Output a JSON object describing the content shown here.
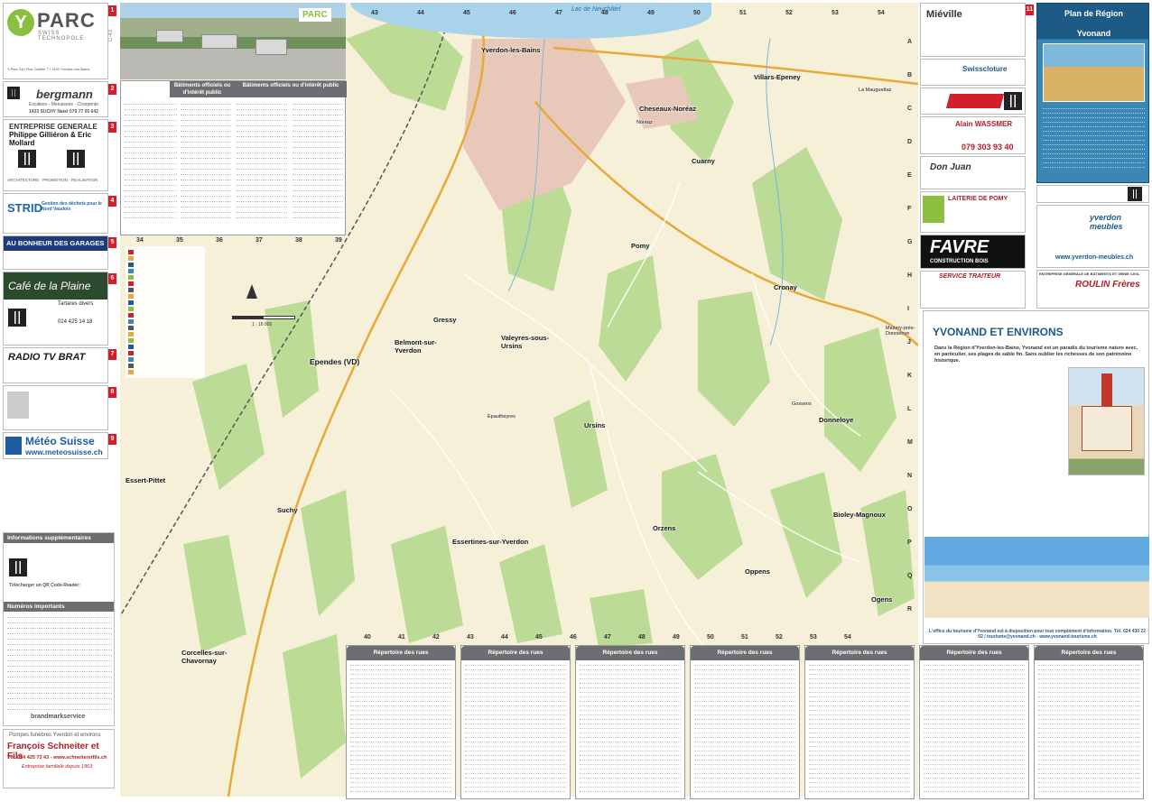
{
  "left": {
    "parc_logo": "Y",
    "parc_name": "PARC",
    "parc_sub": "SWISS TECHNOPOLE",
    "parc_addr": "Y-Parc SA  I  Rue Galilée 7  I  1400 Yverdon-les-Bains",
    "bergmann": "bergmann",
    "bergmann_sub": "Escaliers - Menuiserie - Charpente",
    "bergmann_tel": "1433 SUCHY    Natel 079 77 55 642",
    "entreprise_title": "ENTREPRISE GENERALE",
    "entreprise_names": "Philippe Gilliéron & Eric Mollard",
    "entreprise_foot": "ARCHITECTURE - PROMOTION - REALISATION",
    "strid_name": "STRID",
    "strid_tag": "Gestion des déchets pour le Nord Vaudois",
    "garage_title": "AU BONHEUR DES GARAGES",
    "cafe_title": "Café de la Plaine",
    "cafe_sub": "Tartares divers",
    "cafe_tel": "024 425 14 18",
    "radio_title": "RADIO TV BRAT",
    "meteo_title": "Météo Suisse",
    "meteo_url": "www.meteosuisse.ch",
    "info_head": "Informations supplémentaires",
    "qr_title": "Télécharger un QR Code-Reader:",
    "numeros_head": "Numéros importants",
    "brand": "brandmarkservice",
    "pompes_top": "Pompes funèbres Yverdon et environs",
    "pompes_name": "François Schneiter et Fils",
    "pompes_tel": "Tél. 024 425 73 43 - www.schneiteretfils.ch",
    "pompes_foot": "Entreprise familiale depuis 1963"
  },
  "map": {
    "lake": "Lac de Neuchâtel",
    "inset_logo": "PARC",
    "poi_head_left": "Bâtiments officiels ou d'intérêt public",
    "poi_head_right": "Bâtiments officiels ou d'intérêt public",
    "places": {
      "yverdon": "Yverdon-les-Bains",
      "cheseaux": "Cheseaux-Noréaz",
      "villars": "Villars-Epeney",
      "cuarny": "Cuarny",
      "pomy": "Pomy",
      "cronay": "Cronay",
      "gressy": "Gressy",
      "belmont": "Belmont-sur-Yverdon",
      "ependes": "Ependes (VD)",
      "valeyres": "Valeyres-sous-Ursins",
      "ursins": "Ursins",
      "donneloye": "Donneloye",
      "essert": "Essert-Pittet",
      "suchy": "Suchy",
      "essertines": "Essertines-sur-Yverdon",
      "orzens": "Orzens",
      "bioley": "Bioley-Magnoux",
      "oppens": "Oppens",
      "ogens": "Ogens",
      "corcelles": "Corcelles-sur-Chavornay",
      "gossens": "Gossens",
      "mezery": "Mézery-près-Donneloye",
      "epautheyres": "Epautheyres",
      "noreaz": "Noréaz",
      "lamauguettaz": "La Mauguettaz"
    },
    "top_numbers": [
      "43",
      "44",
      "45",
      "46",
      "47",
      "48",
      "49",
      "50",
      "51",
      "52",
      "53",
      "54"
    ],
    "bottom_numbers": [
      "40",
      "41",
      "42",
      "43",
      "44",
      "45",
      "46",
      "47",
      "48",
      "49",
      "50",
      "51",
      "52",
      "53",
      "54"
    ],
    "left_numbers": [
      "34",
      "35",
      "36",
      "37",
      "38",
      "39"
    ],
    "side_letters": [
      "A",
      "B",
      "C",
      "D",
      "E",
      "F",
      "G",
      "H",
      "I",
      "J",
      "K",
      "L",
      "M",
      "N",
      "O",
      "P",
      "Q",
      "R"
    ],
    "scale_label": "1 : 16 000"
  },
  "index": {
    "header": "Répertoire des rues"
  },
  "right": {
    "mieville": "Miéville",
    "swisscloture": "Swisscloture",
    "wassmer_name": "Alain WASSMER",
    "wassmer_tel": "079 303 93 40",
    "wassmer_sub": "Dépannage  Chauffage, brûleurs sanitaire, solaire",
    "donjuan": "Don Juan",
    "laiterie": "LAITERIE DE POMY",
    "favre": "FAVRE",
    "favre_sub": "CONSTRUCTION BOIS",
    "traiteur": "SERVICE TRAITEUR",
    "yverdon_meubles": "yverdon meubles",
    "yverdon_meubles_url": "www.yverdon-meubles.ch",
    "roulin": "ROULIN Frères",
    "roulin_head": "ENTREPRISE GÉNÉRALE DE BÂTIMENTS ET GÉNIE CIVIL",
    "plan_title": "Plan de Région",
    "plan_sub": "Yvonand",
    "art_title": "YVONAND ET ENVIRONS",
    "art_intro": "Dans la Région d'Yverdon-les-Bains, Yvonand est un paradis du tourisme nature avec, en particulier, ses plages de sable fin. Sans oublier les richesses de son patrimoine historique.",
    "art_foot": "L'office du tourisme d'Yvonand est à disposition pour tout complément d'information. Tél. 024 430 22 02 / tourisme@yvonand.ch - www.yvonand-tourisme.ch"
  },
  "colors": {
    "accent_red": "#d21f2b",
    "header_grey": "#6d6e71",
    "forest": "#a6cf83",
    "field": "#f5f0d7",
    "lake": "#a9d3ea",
    "plan_blue": "#1e5a86"
  }
}
